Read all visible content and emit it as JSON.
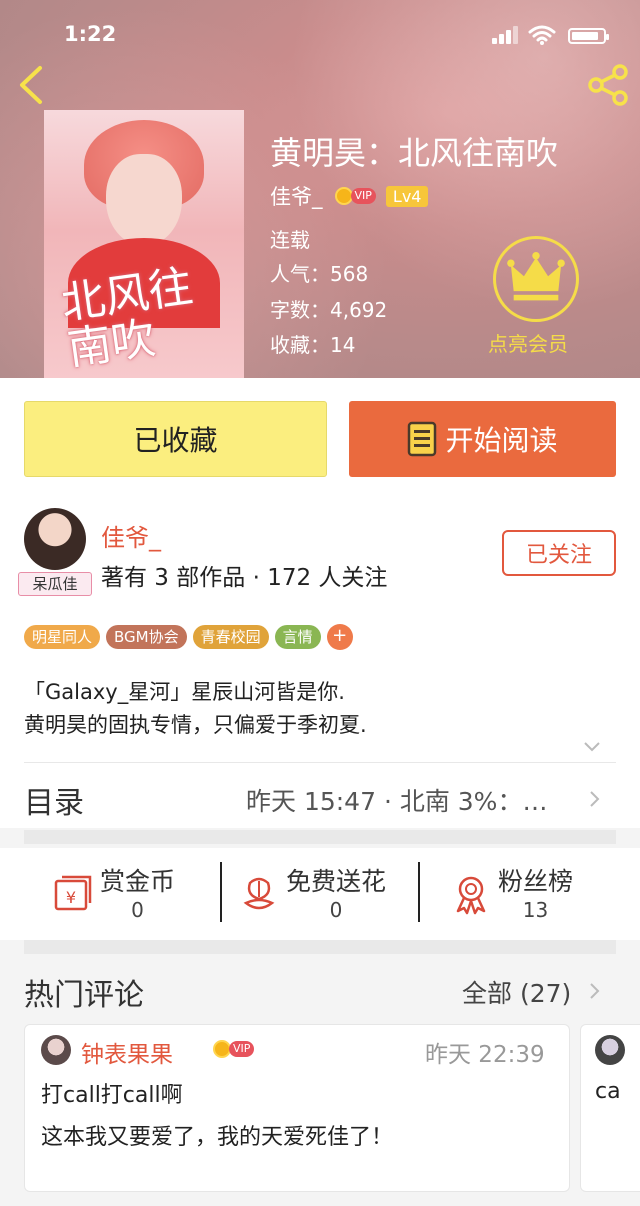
{
  "status_bar": {
    "time": "1:22"
  },
  "book": {
    "title": "黄明昊：北风往南吹",
    "cover_title": "北风往南吹",
    "author": "佳爷_",
    "vip": "VIP",
    "level": "Lv4",
    "status": "连载",
    "popularity": "人气：568",
    "word_count": "字数：4,692",
    "favorites": "收藏：14",
    "member_label": "点亮会员"
  },
  "buttons": {
    "collected": "已收藏",
    "start_reading": "开始阅读"
  },
  "author_info": {
    "name": "佳爷_",
    "badge": "呆瓜佳",
    "stats": "著有 3 部作品 · 172 人关注",
    "follow": "已关注"
  },
  "tags": [
    {
      "label": "明星同人",
      "color": "#f0a94a"
    },
    {
      "label": "BGM协会",
      "color": "#c2745a"
    },
    {
      "label": "青春校园",
      "color": "#e0a33a"
    },
    {
      "label": "言情",
      "color": "#8ab653"
    }
  ],
  "tag_more": "+",
  "intro": {
    "line1": "「Galaxy_星河」星辰山河皆是你.",
    "line2": "黄明昊的固执专情，只偏爱于季初夏."
  },
  "toc": {
    "title": "目录",
    "latest": "昨天 15:47 · 北南 3%：…"
  },
  "actions": [
    {
      "label": "赏金币",
      "value": "0"
    },
    {
      "label": "免费送花",
      "value": "0"
    },
    {
      "label": "粉丝榜",
      "value": "13"
    }
  ],
  "comments": {
    "title": "热门评论",
    "all": "全部 (27)",
    "items": [
      {
        "user": "钟表果果",
        "vip": "VIP",
        "time": "昨天 22:39",
        "line1": "打call打call啊",
        "line2": "这本我又要爱了，我的天爱死佳了！"
      },
      {
        "text": "ca"
      }
    ]
  },
  "colors": {
    "accent": "#e2583e",
    "read_button": "#ea6a3e",
    "collected_button": "#fbee7f",
    "crown": "#f5dc48"
  }
}
